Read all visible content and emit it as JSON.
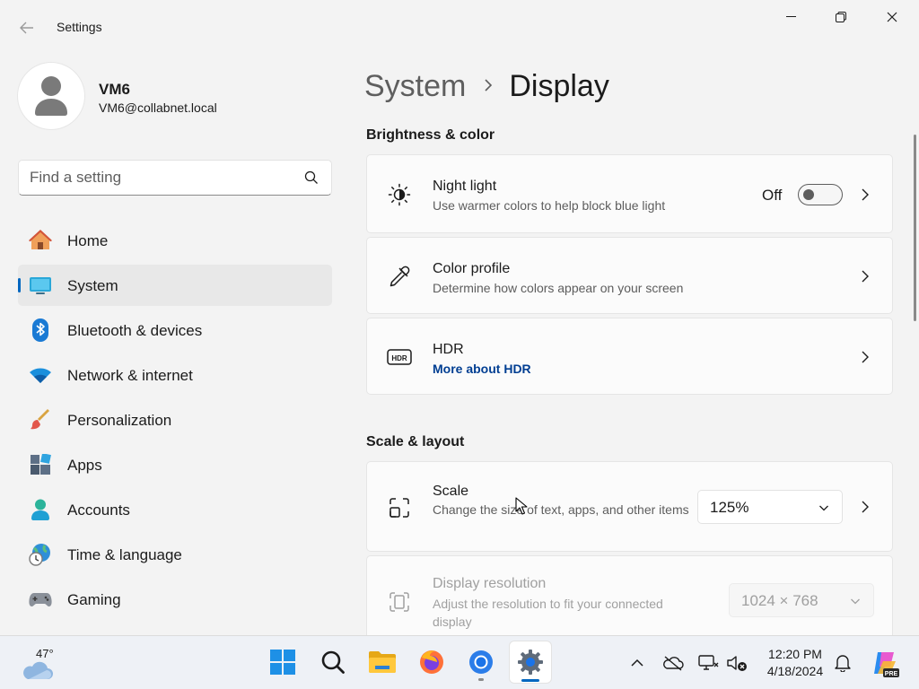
{
  "window": {
    "title": "Settings"
  },
  "profile": {
    "name": "VM6",
    "email": "VM6@collabnet.local"
  },
  "search": {
    "placeholder": "Find a setting"
  },
  "nav": {
    "items": [
      {
        "label": "Home",
        "icon": "home-icon"
      },
      {
        "label": "System",
        "icon": "system-icon",
        "active": true
      },
      {
        "label": "Bluetooth & devices",
        "icon": "bluetooth-icon"
      },
      {
        "label": "Network & internet",
        "icon": "wifi-icon"
      },
      {
        "label": "Personalization",
        "icon": "brush-icon"
      },
      {
        "label": "Apps",
        "icon": "apps-icon"
      },
      {
        "label": "Accounts",
        "icon": "person-icon"
      },
      {
        "label": "Time & language",
        "icon": "globe-clock-icon"
      },
      {
        "label": "Gaming",
        "icon": "gamepad-icon"
      }
    ]
  },
  "breadcrumb": {
    "parent": "System",
    "current": "Display"
  },
  "sections": {
    "brightness": {
      "title": "Brightness & color",
      "night_light": {
        "title": "Night light",
        "subtitle": "Use warmer colors to help block blue light",
        "state": "Off"
      },
      "color_profile": {
        "title": "Color profile",
        "subtitle": "Determine how colors appear on your screen"
      },
      "hdr": {
        "title": "HDR",
        "link": "More about HDR"
      }
    },
    "scale_layout": {
      "title": "Scale & layout",
      "scale": {
        "title": "Scale",
        "subtitle": "Change the size of text, apps, and other items",
        "value": "125%"
      },
      "resolution": {
        "title": "Display resolution",
        "subtitle": "Adjust the resolution to fit your connected display",
        "value": "1024 × 768"
      }
    }
  },
  "taskbar": {
    "weather_temp": "47°",
    "apps": [
      "start-icon",
      "search-icon",
      "file-explorer-icon",
      "firefox-icon",
      "chrome-icon",
      "settings-icon"
    ],
    "time": "12:20 PM",
    "date": "4/18/2024"
  },
  "colors": {
    "accent": "#0067c0",
    "link": "#003e92",
    "background": "#f3f3f3"
  }
}
